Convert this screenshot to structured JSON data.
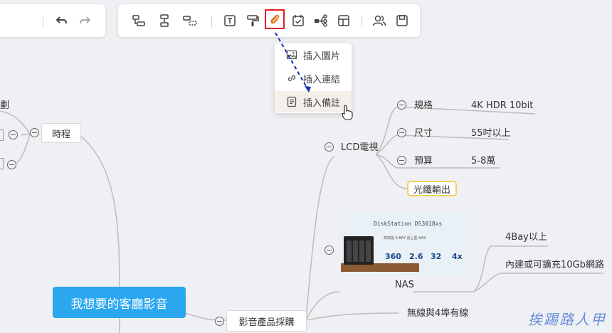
{
  "toolbar": {
    "tools": [
      "undo-icon",
      "redo-icon",
      "insert-subtopic-icon",
      "insert-topic-icon",
      "insert-floating-icon",
      "text-icon",
      "format-painter-icon",
      "attachment-icon",
      "task-icon",
      "relationship-icon",
      "layout-icon",
      "collaborate-icon",
      "save-icon"
    ]
  },
  "insert_menu": {
    "items": [
      {
        "label": "插入圖片",
        "icon": "image-icon"
      },
      {
        "label": "插入連結",
        "icon": "link-icon"
      },
      {
        "label": "插入備註",
        "icon": "note-icon"
      }
    ]
  },
  "mindmap": {
    "root": "我想要的客廳影音",
    "schedule": "時程",
    "left_fragment": "劃",
    "av_purchase": "影音產品採購",
    "lcd_tv": "LCD電視",
    "spec": "規格",
    "spec_value": "4K HDR 10bit",
    "size": "尺寸",
    "size_value": "55吋以上",
    "budget": "預算",
    "budget_value": "5-8萬",
    "optical_out": "光纖輸出",
    "nas": "NAS",
    "nas_item1": "4Bay以上",
    "nas_item2": "內建或可擴充10Gb網路",
    "wireless": "無線與4埠有線"
  },
  "nas_image": {
    "model": "DiskStation DS3018xs",
    "desc": "高效能 6 BAY 桌上型 NAS",
    "stat1": "360",
    "stat2": "2.6",
    "stat3": "32",
    "stat4": "4x"
  },
  "watermark": "挨踢路人甲",
  "colors": {
    "accent": "#2aa7ef",
    "highlight_border": "#e02020",
    "note_border": "#ecd25f",
    "dashed_arrow": "#1a2fb0"
  }
}
